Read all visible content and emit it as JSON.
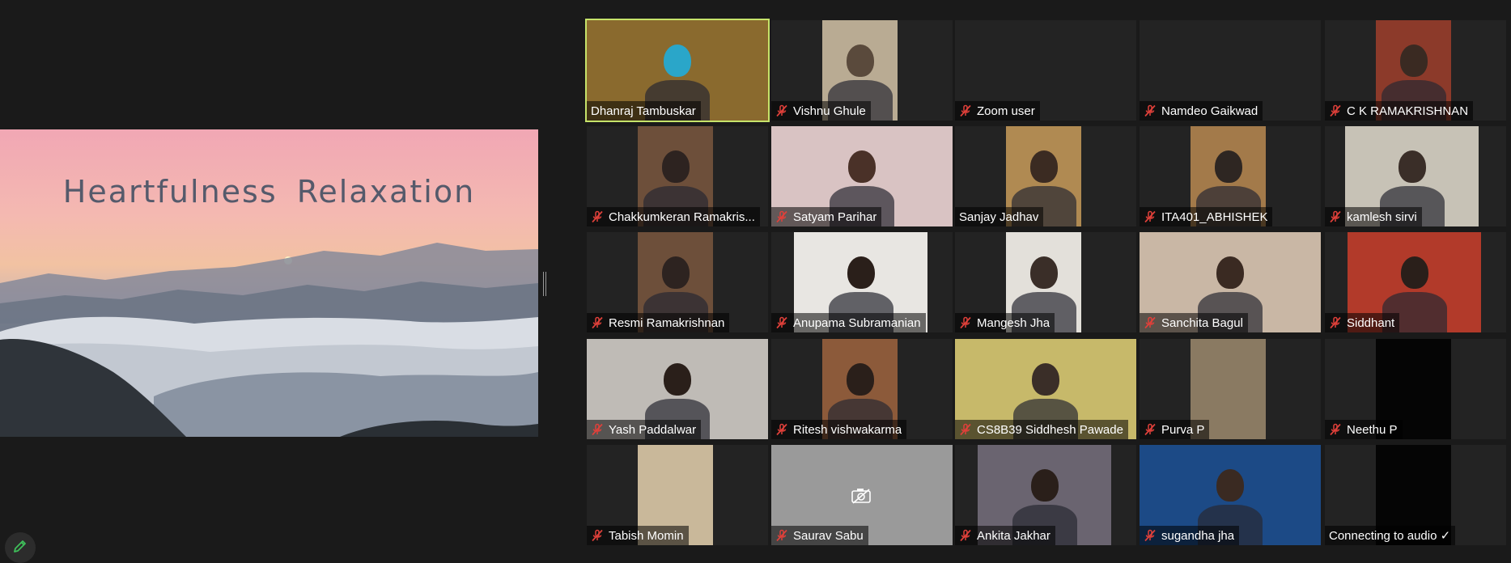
{
  "shared_screen": {
    "title": "Heartfulness  Relaxation"
  },
  "participants": [
    {
      "name": "Dhanraj  Tambuskar",
      "muted": false,
      "active": true,
      "video": true
    },
    {
      "name": "Vishnu Ghule",
      "muted": true,
      "active": false,
      "video": true
    },
    {
      "name": "Zoom user",
      "muted": true,
      "active": false,
      "video": false
    },
    {
      "name": "Namdeo Gaikwad",
      "muted": true,
      "active": false,
      "video": false
    },
    {
      "name": "C K RAMAKRISHNAN",
      "muted": true,
      "active": false,
      "video": true
    },
    {
      "name": "Chakkumkeran Ramakris...",
      "muted": true,
      "active": false,
      "video": true
    },
    {
      "name": "Satyam Parihar",
      "muted": true,
      "active": false,
      "video": true
    },
    {
      "name": "Sanjay Jadhav",
      "muted": false,
      "active": false,
      "video": true
    },
    {
      "name": "ITA401_ABHISHEK",
      "muted": true,
      "active": false,
      "video": true
    },
    {
      "name": "kamlesh sirvi",
      "muted": true,
      "active": false,
      "video": true
    },
    {
      "name": "Resmi Ramakrishnan",
      "muted": true,
      "active": false,
      "video": true
    },
    {
      "name": "Anupama Subramanian",
      "muted": true,
      "active": false,
      "video": true
    },
    {
      "name": "Mangesh Jha",
      "muted": true,
      "active": false,
      "video": true
    },
    {
      "name": "Sanchita Bagul",
      "muted": true,
      "active": false,
      "video": true
    },
    {
      "name": "Siddhant",
      "muted": true,
      "active": false,
      "video": true
    },
    {
      "name": "Yash Paddalwar",
      "muted": true,
      "active": false,
      "video": true
    },
    {
      "name": "Ritesh vishwakarma",
      "muted": true,
      "active": false,
      "video": true
    },
    {
      "name": "CS8B39 Siddhesh Pawade",
      "muted": true,
      "active": false,
      "video": true
    },
    {
      "name": "Purva P",
      "muted": true,
      "active": false,
      "video": true
    },
    {
      "name": "Neethu P",
      "muted": true,
      "active": false,
      "video": true
    },
    {
      "name": "Tabish Momin",
      "muted": true,
      "active": false,
      "video": true
    },
    {
      "name": "Saurav Sabu",
      "muted": true,
      "active": false,
      "video": false,
      "camera_off": true
    },
    {
      "name": "Ankita Jakhar",
      "muted": true,
      "active": false,
      "video": true
    },
    {
      "name": "sugandha jha",
      "muted": true,
      "active": false,
      "video": true
    },
    {
      "name": "Connecting to audio ✓",
      "muted": false,
      "active": false,
      "video": true
    }
  ],
  "colors": {
    "background": "#1a1a1a",
    "tile": "#232323",
    "active_speaker_border": "#c6e36a",
    "muted_icon": "#e0403a"
  },
  "icons": {
    "mute": "microphone-muted-icon",
    "camera_off": "camera-off-icon",
    "annotate": "pencil-icon"
  }
}
